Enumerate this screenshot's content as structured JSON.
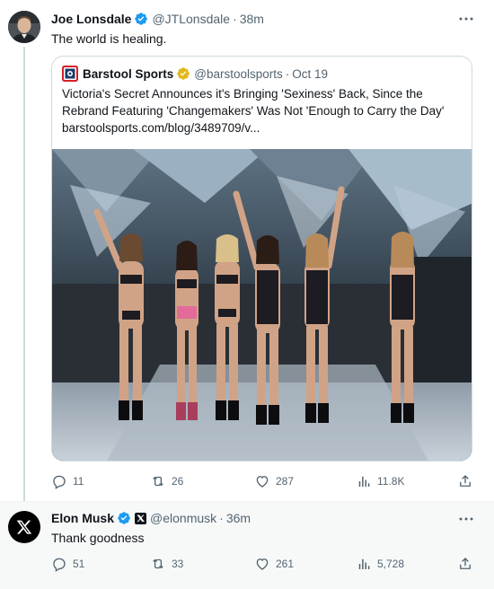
{
  "tweets": [
    {
      "author": {
        "name": "Joe Lonsdale",
        "handle": "@JTLonsdale",
        "time": "38m"
      },
      "text": "The world is healing.",
      "quote": {
        "author": {
          "name": "Barstool Sports",
          "handle": "@barstoolsports",
          "date": "Oct 19"
        },
        "lines": [
          "Victoria's Secret Announces it's Bringing 'Sexiness' Back, Since the",
          "Rebrand Featuring 'Changemakers' Was Not 'Enough to Carry the Day'",
          "barstoolsports.com/blog/3489709/v..."
        ]
      },
      "stats": {
        "replies": "11",
        "reposts": "26",
        "likes": "287",
        "views": "11.8K"
      }
    },
    {
      "author": {
        "name": "Elon Musk",
        "handle": "@elonmusk",
        "time": "36m"
      },
      "text": "Thank goodness",
      "stats": {
        "replies": "51",
        "reposts": "33",
        "likes": "261",
        "views": "5,728"
      }
    }
  ],
  "separator": "·",
  "colors": {
    "verified_blue": "#1d9bf0",
    "verified_gold": "#e2b719",
    "secondary_text": "#536471",
    "border": "#cfd9de"
  },
  "icons": [
    "verified-badge-icon",
    "x-logo-icon",
    "more-options-icon",
    "reply-icon",
    "repost-icon",
    "like-icon",
    "views-icon",
    "share-icon"
  ]
}
